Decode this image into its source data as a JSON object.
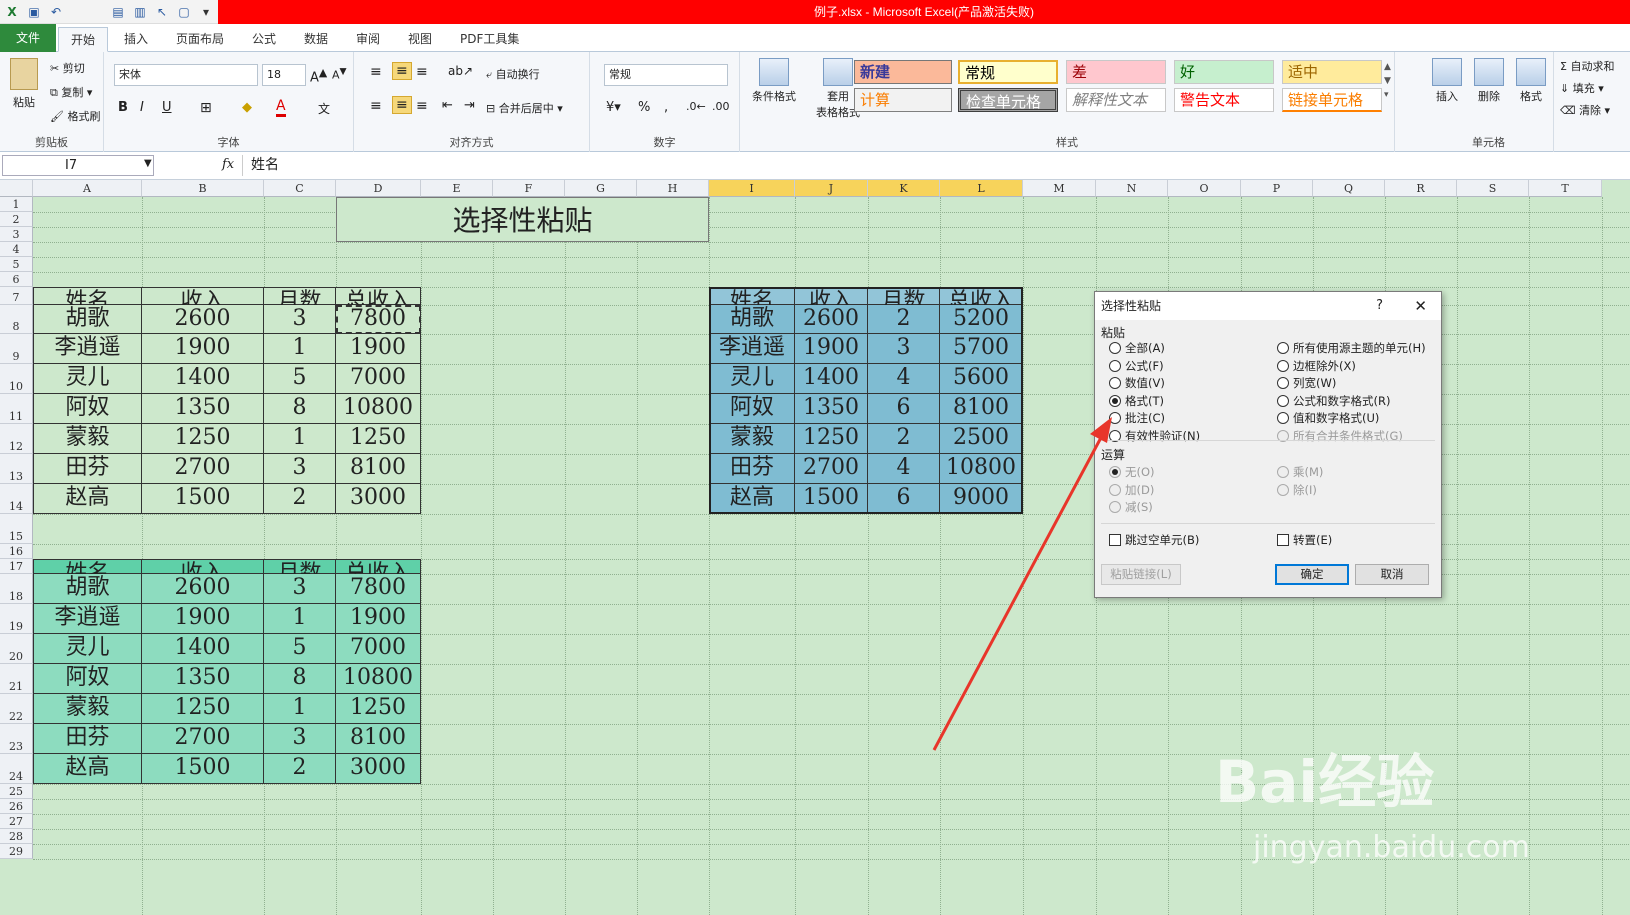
{
  "app_title": "例子.xlsx - Microsoft Excel(产品激活失败)",
  "tabs": [
    "文件",
    "开始",
    "插入",
    "页面布局",
    "公式",
    "数据",
    "审阅",
    "视图",
    "PDF工具集"
  ],
  "ribbon": {
    "clipboard": {
      "paste": "粘贴",
      "cut": "剪切",
      "copy": "复制",
      "format_painter": "格式刷",
      "label": "剪贴板"
    },
    "font": {
      "name": "宋体",
      "size": "18",
      "label": "字体"
    },
    "alignment": {
      "wrap": "自动换行",
      "merge": "合并后居中",
      "label": "对齐方式"
    },
    "number": {
      "format": "常规",
      "label": "数字",
      "percent": "%",
      "comma": ","
    },
    "styles": {
      "cond": "条件格式",
      "table1": "套用",
      "table2": "表格格式",
      "label": "样式",
      "items": [
        "新建",
        "常规",
        "差",
        "好",
        "适中",
        "计算",
        "检查单元格",
        "解释性文本",
        "警告文本",
        "链接单元格"
      ]
    },
    "cells": {
      "insert": "插入",
      "delete": "删除",
      "format": "格式",
      "label": "单元格"
    },
    "editing": {
      "autosum": "自动求和",
      "fill": "填充",
      "clear": "清除"
    }
  },
  "formula_bar": {
    "name_box": "I7",
    "fx": "fx",
    "content": "姓名"
  },
  "columns": [
    "A",
    "B",
    "C",
    "D",
    "E",
    "F",
    "G",
    "H",
    "I",
    "J",
    "K",
    "L",
    "M",
    "N",
    "O",
    "P",
    "Q",
    "R",
    "S",
    "T"
  ],
  "rows": [
    "1",
    "2",
    "3",
    "4",
    "5",
    "6",
    "7",
    "8",
    "9",
    "10",
    "11",
    "12",
    "13",
    "14",
    "15",
    "16",
    "17",
    "18",
    "19",
    "20",
    "21",
    "22",
    "23",
    "24",
    "25",
    "26",
    "27",
    "28",
    "29"
  ],
  "sheet_title": "选择性粘贴",
  "table1": {
    "header": [
      "姓名",
      "收入",
      "月数",
      "总收入"
    ],
    "rows": [
      [
        "胡歌",
        "2600",
        "3",
        "7800"
      ],
      [
        "李逍遥",
        "1900",
        "1",
        "1900"
      ],
      [
        "灵儿",
        "1400",
        "5",
        "7000"
      ],
      [
        "阿奴",
        "1350",
        "8",
        "10800"
      ],
      [
        "蒙毅",
        "1250",
        "1",
        "1250"
      ],
      [
        "田芬",
        "2700",
        "3",
        "8100"
      ],
      [
        "赵高",
        "1500",
        "2",
        "3000"
      ]
    ]
  },
  "table2": {
    "header": [
      "姓名",
      "收入",
      "月数",
      "总收入"
    ],
    "rows": [
      [
        "胡歌",
        "2600",
        "2",
        "5200"
      ],
      [
        "李逍遥",
        "1900",
        "3",
        "5700"
      ],
      [
        "灵儿",
        "1400",
        "4",
        "5600"
      ],
      [
        "阿奴",
        "1350",
        "6",
        "8100"
      ],
      [
        "蒙毅",
        "1250",
        "2",
        "2500"
      ],
      [
        "田芬",
        "2700",
        "4",
        "10800"
      ],
      [
        "赵高",
        "1500",
        "6",
        "9000"
      ]
    ]
  },
  "table3": {
    "header": [
      "姓名",
      "收入",
      "月数",
      "总收入"
    ],
    "rows": [
      [
        "胡歌",
        "2600",
        "3",
        "7800"
      ],
      [
        "李逍遥",
        "1900",
        "1",
        "1900"
      ],
      [
        "灵儿",
        "1400",
        "5",
        "7000"
      ],
      [
        "阿奴",
        "1350",
        "8",
        "10800"
      ],
      [
        "蒙毅",
        "1250",
        "1",
        "1250"
      ],
      [
        "田芬",
        "2700",
        "3",
        "8100"
      ],
      [
        "赵高",
        "1500",
        "2",
        "3000"
      ]
    ]
  },
  "dialog": {
    "title": "选择性粘贴",
    "help": "?",
    "close": "✕",
    "paste_label": "粘贴",
    "paste_left": [
      "全部(A)",
      "公式(F)",
      "数值(V)",
      "格式(T)",
      "批注(C)",
      "有效性验证(N)"
    ],
    "paste_right": [
      "所有使用源主题的单元(H)",
      "边框除外(X)",
      "列宽(W)",
      "公式和数字格式(R)",
      "值和数字格式(U)",
      "所有合并条件格式(G)"
    ],
    "op_label": "运算",
    "op_left": [
      "无(O)",
      "加(D)",
      "减(S)"
    ],
    "op_right": [
      "乘(M)",
      "除(I)"
    ],
    "skip_blanks": "跳过空单元(B)",
    "transpose": "转置(E)",
    "paste_link": "粘贴链接(L)",
    "ok": "确定",
    "cancel": "取消"
  },
  "watermark": {
    "main": "Bai经验",
    "sub": "jingyan.baidu.com"
  }
}
